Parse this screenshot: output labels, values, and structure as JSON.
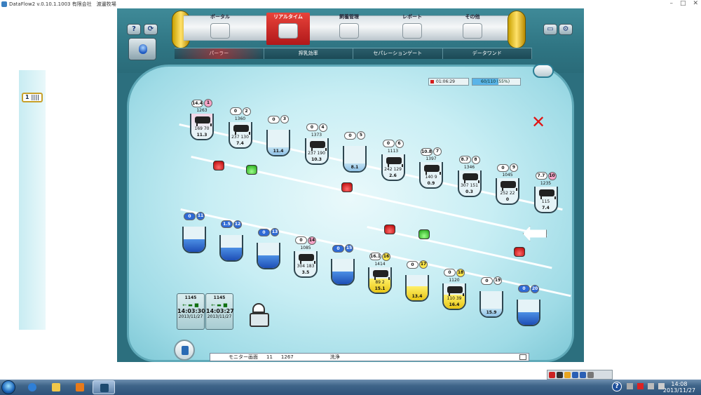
{
  "window": {
    "title": "DataFlow2 v.0.10.1.1003 有限会社　渡邊牧場"
  },
  "nav": {
    "tabs": [
      {
        "label": "ポータル"
      },
      {
        "label": "リアルタイム"
      },
      {
        "label": "飼養管理"
      },
      {
        "label": "レポート"
      },
      {
        "label": "その他"
      }
    ],
    "subtabs": [
      {
        "label": "パーラー"
      },
      {
        "label": "搾乳効率"
      },
      {
        "label": "セパレーションゲート"
      },
      {
        "label": "データワンド"
      }
    ],
    "help_label": "?"
  },
  "side": {
    "bookmark_label": "1"
  },
  "status": {
    "time": "01:06:29",
    "progress": "60/110 (55%)",
    "progress_fraction": 0.55
  },
  "top_row": [
    {
      "b1": "14.4",
      "b2": "1",
      "yield": "1263",
      "c1": "169",
      "c2": "70",
      "val": "11.3",
      "color": "pink",
      "cow": true,
      "b2color": "pink"
    },
    {
      "b1": "0",
      "b2": "2",
      "yield": "1360",
      "c1": "237",
      "c2": "130",
      "val": "7.4",
      "cow": true
    },
    {
      "b1": "0",
      "b2": "3",
      "yield": "",
      "val": "11.4",
      "fill": "light"
    },
    {
      "b1": "0",
      "b2": "4",
      "yield": "1373",
      "c1": "237",
      "c2": "190",
      "val": "10.3",
      "cow": true
    },
    {
      "b1": "0",
      "b2": "5",
      "yield": "",
      "val": "8.1",
      "fill": "light"
    },
    {
      "b1": "0",
      "b2": "6",
      "yield": "1113",
      "c1": "242",
      "c2": "129",
      "val": "2.6",
      "cow": true
    },
    {
      "b1": "10.8",
      "b2": "7",
      "yield": "1397",
      "c1": "140",
      "c2": "9",
      "val": "0.9",
      "cow": true
    },
    {
      "b1": "8.7",
      "b2": "8",
      "yield": "1346",
      "c1": "307",
      "c2": "151",
      "val": "0.3",
      "cow": true
    },
    {
      "b1": "0",
      "b2": "9",
      "yield": "1045",
      "c1": "252",
      "c2": "22",
      "val": "0",
      "cow": true
    },
    {
      "b1": "7.7",
      "b2": "10",
      "yield": "1235",
      "c1": "115",
      "c2": "",
      "val": "7.4",
      "cow": true,
      "b2color": "pink"
    }
  ],
  "bottom_row": [
    {
      "b1": "0",
      "b2": "11",
      "fill": "blue"
    },
    {
      "b1": "1.5",
      "b2": "12",
      "fill": "blue"
    },
    {
      "b1": "0",
      "b2": "13",
      "fill": "blue"
    },
    {
      "b1": "0",
      "b2": "14",
      "yield": "1085",
      "c1": "304",
      "c2": "183",
      "val": "3.5",
      "cow": true,
      "b2color": "pink"
    },
    {
      "b1": "0",
      "b2": "15",
      "fill": "blue"
    },
    {
      "b1": "16.1",
      "b2": "16",
      "yield": "1414",
      "c1": "89",
      "c2": "2",
      "val": "15.1",
      "fill": "yellow",
      "cow": true,
      "b2color": "yellow"
    },
    {
      "b1": "0",
      "b2": "17",
      "val": "13.4",
      "fill": "yellow",
      "b2color": "yellow"
    },
    {
      "b1": "0",
      "b2": "18",
      "yield": "1120",
      "c1": "110",
      "c2": "39",
      "val": "16.4",
      "fill": "yellow",
      "cow": true,
      "b2color": "yellow"
    },
    {
      "b1": "0",
      "b2": "19",
      "val": "15.9",
      "fill": "light"
    },
    {
      "b1": "0",
      "b2": "20",
      "fill": "blue"
    }
  ],
  "tanks": [
    {
      "id": "1145",
      "time": "14:03:30",
      "date": "2013/11/27"
    },
    {
      "id": "1145",
      "time": "14:03:27",
      "date": "2013/11/27"
    }
  ],
  "monitor": {
    "label": "モニター画面",
    "num": "11",
    "cow": "1267",
    "status": "洗浄"
  },
  "clock": {
    "time": "14:08",
    "date": "2013/11/27"
  },
  "colors": {
    "accent_red": "#d51b1b",
    "panel_bg": "#c8eef4",
    "frame": "#2c6f7e"
  }
}
